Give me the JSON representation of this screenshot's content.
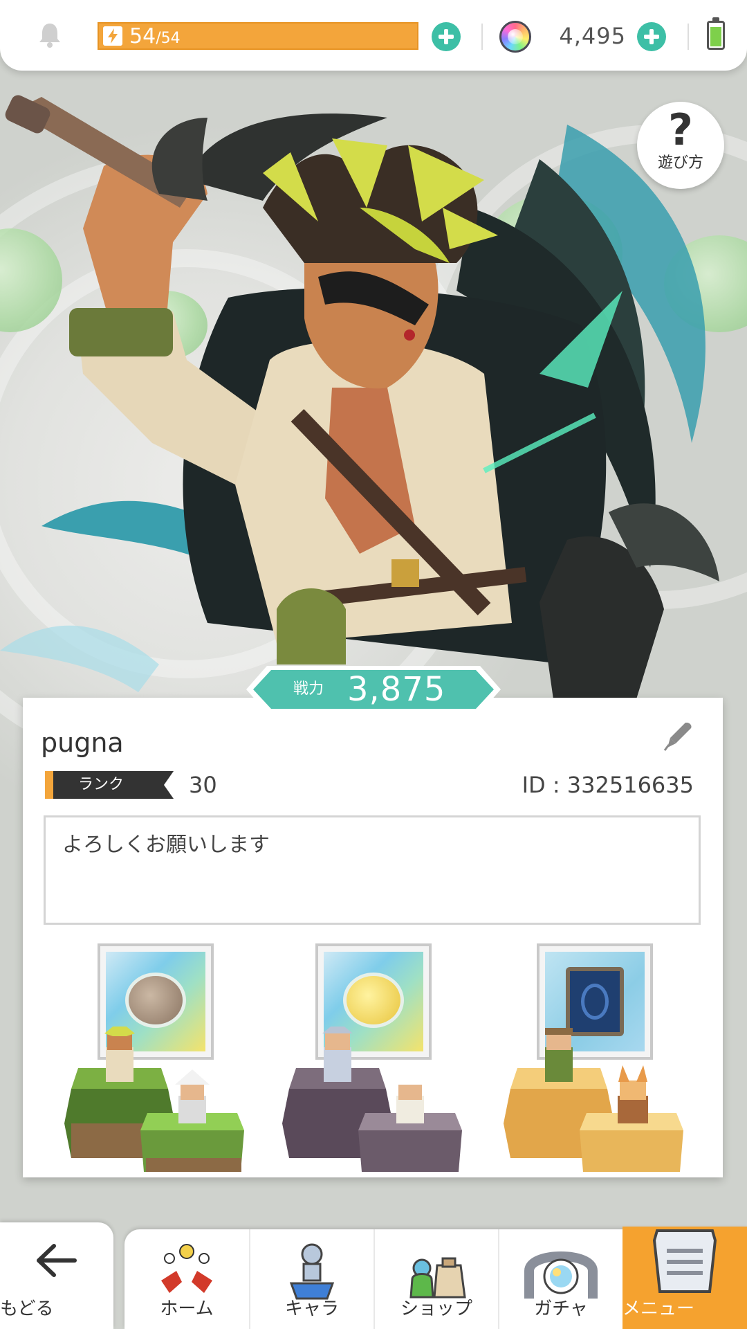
{
  "status_bar": {
    "stamina_current": "54",
    "stamina_separator": "/",
    "stamina_max": "54",
    "stamina_fraction": 1.0,
    "gems": "4,495"
  },
  "help_button": {
    "label": "遊び方",
    "symbol": "?"
  },
  "power": {
    "label": "戦力",
    "value": "3,875"
  },
  "profile": {
    "name": "pugna",
    "rank_label": "ランク",
    "rank": "30",
    "id_text": "ID : 332516635",
    "comment": "よろしくお願いします"
  },
  "party": [
    {
      "slot": 1,
      "item_icon": "stone-platter-icon",
      "pedestal_color": "#6a9a3c"
    },
    {
      "slot": 2,
      "item_icon": "golden-platter-icon",
      "pedestal_color": "#6b5b6a"
    },
    {
      "slot": 3,
      "item_icon": "blue-tome-icon",
      "pedestal_color": "#e8b65a"
    }
  ],
  "nav": {
    "back": "もどる",
    "items": [
      "ホーム",
      "キャラ",
      "ショップ",
      "ガチャ"
    ],
    "menu": "メニュー"
  },
  "colors": {
    "accent_teal": "#3dbfa6",
    "stamina_orange": "#f3a53b",
    "menu_orange": "#f5a22f",
    "rank_dark": "#333333"
  }
}
